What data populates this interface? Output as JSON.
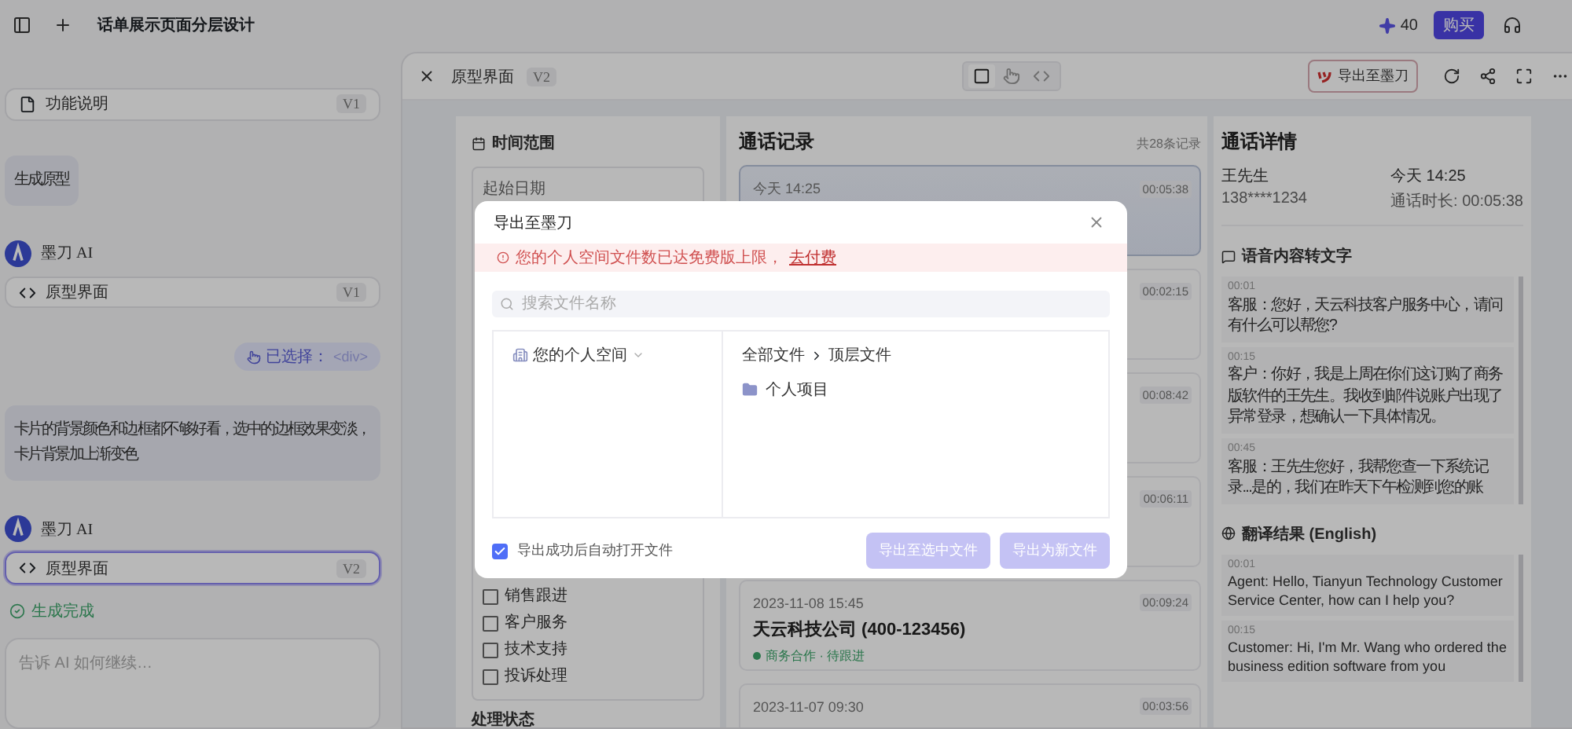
{
  "topbar": {
    "title": "话单展示页面分层设计",
    "credits": "40",
    "buy_button": "购买"
  },
  "chat": {
    "items": [
      {
        "kind": "document_card",
        "title": "功能说明",
        "version": "V1",
        "selected": false
      },
      {
        "kind": "user",
        "text": "生成原型"
      },
      {
        "kind": "ai",
        "name": "墨刀 AI"
      },
      {
        "kind": "code_card",
        "title": "原型界面",
        "version": "V1",
        "selected": false
      },
      {
        "kind": "selection_tag",
        "label": "已选择：",
        "value": "<div>"
      },
      {
        "kind": "user",
        "text": "卡片的背景颜色和边框都不够好看，选中的边框效果变淡，卡片背景加上渐变色"
      },
      {
        "kind": "ai",
        "name": "墨刀 AI"
      },
      {
        "kind": "code_card",
        "title": "原型界面",
        "version": "V2",
        "selected": true
      },
      {
        "kind": "status",
        "text": "生成完成"
      }
    ],
    "input": {
      "placeholder": "告诉 AI 如何继续…"
    }
  },
  "preview": {
    "title": "原型界面",
    "version": "V2",
    "view_modes": [
      {
        "selected": true
      },
      {
        "selected": false
      },
      {
        "selected": false
      }
    ],
    "export_button": "导出至墨刀"
  },
  "filters": {
    "title": "时间范围",
    "start_label": "起始日期",
    "categories": [
      {
        "label": "销售跟进",
        "checked": false
      },
      {
        "label": "客户服务",
        "checked": false
      },
      {
        "label": "技术支持",
        "checked": false
      },
      {
        "label": "投诉处理",
        "checked": false
      }
    ],
    "status_title": "处理状态"
  },
  "call_list": {
    "title": "通话记录",
    "count": "共28条记录",
    "cards": [
      {
        "time": "今天 14:25",
        "duration": "00:05:38",
        "selected": true
      },
      {
        "duration": "00:02:15",
        "selected": false
      },
      {
        "duration": "00:08:42",
        "selected": false
      },
      {
        "duration": "00:06:11",
        "selected": false
      },
      {
        "time": "2023-11-08 15:45",
        "duration": "00:09:24",
        "name": "天云科技公司 (400-123456)",
        "tag": "商务合作 · 待跟进",
        "selected": false
      },
      {
        "time": "2023-11-07 09:30",
        "duration": "00:03:56",
        "selected": false
      }
    ]
  },
  "details": {
    "title": "通话详情",
    "caller": "王先生",
    "phone": "138****1234",
    "time": "今天 14:25",
    "duration": "通话时长: 00:05:38",
    "sections": [
      {
        "kind": "transcript",
        "title": "语音内容转文字",
        "messages": [
          {
            "time": "00:01",
            "text": "客服：您好，天云科技客户服务中心，请问有什么可以帮您?"
          },
          {
            "time": "00:15",
            "text": "客户：你好，我是上周在你们这订购了商务版软件的王先生。我收到邮件说账户出现了异常登录，想确认一下具体情况。"
          },
          {
            "time": "00:45",
            "text": "客服：王先生您好，我帮您查一下系统记录...是的，我们在昨天下午检测到您的账"
          }
        ]
      },
      {
        "kind": "translation",
        "title": "翻译结果 (English)",
        "messages": [
          {
            "time": "00:01",
            "text": "Agent: Hello, Tianyun Technology Customer Service Center, how can I help you?"
          },
          {
            "time": "00:15",
            "text": "Customer: Hi, I'm Mr. Wang who ordered the business edition software from you"
          }
        ]
      }
    ]
  },
  "modal": {
    "title": "导出至墨刀",
    "alert": "您的个人空间文件数已达免费版上限，",
    "alert_link": "去付费",
    "search_placeholder": "搜索文件名称",
    "space": "您的个人空间",
    "breadcrumb": [
      "全部文件",
      "顶层文件"
    ],
    "folders": [
      "个人项目"
    ],
    "auto_open": {
      "label": "导出成功后自动打开文件",
      "checked": true
    },
    "buttons": [
      {
        "label": "导出至选中文件",
        "disabled": true
      },
      {
        "label": "导出为新文件",
        "disabled": true
      }
    ]
  }
}
